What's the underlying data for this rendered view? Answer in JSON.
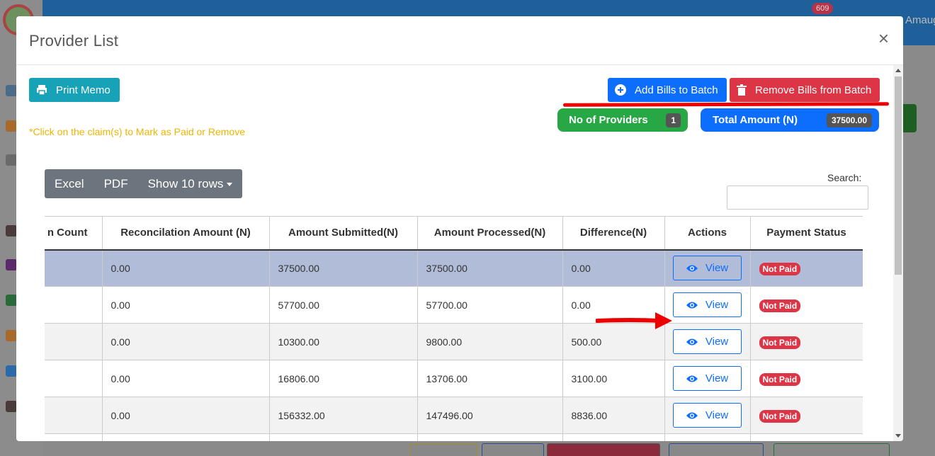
{
  "background": {
    "notification_count": "609",
    "user_name": "Amaug"
  },
  "modal": {
    "title": "Provider List",
    "close_label": "×",
    "print_memo": "Print Memo",
    "add_bills": "Add Bills to Batch",
    "remove_bills": "Remove Bills from Batch",
    "providers_label": "No of Providers",
    "providers_count": "1",
    "total_label": "Total Amount (N)",
    "total_value": "37500.00",
    "hint": "*Click on the claim(s) to Mark as Paid or Remove"
  },
  "table_controls": {
    "excel": "Excel",
    "pdf": "PDF",
    "show_rows": "Show 10 rows",
    "search_label": "Search:",
    "search_value": ""
  },
  "table": {
    "headers": [
      "n Count",
      "Reconcilation Amount (N)",
      "Amount Submitted(N)",
      "Amount Processed(N)",
      "Difference(N)",
      "Actions",
      "Payment Status"
    ],
    "view_label": "View",
    "rows": [
      {
        "count": "",
        "reconciliation": "0.00",
        "submitted": "37500.00",
        "processed": "37500.00",
        "difference": "0.00",
        "status": "Not Paid"
      },
      {
        "count": "",
        "reconciliation": "0.00",
        "submitted": "57700.00",
        "processed": "57700.00",
        "difference": "0.00",
        "status": "Not Paid"
      },
      {
        "count": "",
        "reconciliation": "0.00",
        "submitted": "10300.00",
        "processed": "9800.00",
        "difference": "500.00",
        "status": "Not Paid"
      },
      {
        "count": "",
        "reconciliation": "0.00",
        "submitted": "16806.00",
        "processed": "13706.00",
        "difference": "3100.00",
        "status": "Not Paid"
      },
      {
        "count": "",
        "reconciliation": "0.00",
        "submitted": "156332.00",
        "processed": "147496.00",
        "difference": "8836.00",
        "status": "Not Paid"
      },
      {
        "count": "",
        "reconciliation": "",
        "submitted": "",
        "processed": "",
        "difference": "",
        "status": ""
      }
    ]
  },
  "colors": {
    "primary": "#0d6efd",
    "danger": "#dc3545",
    "success": "#28a745",
    "info": "#17a2b8",
    "selected_row": "#b0bcd8"
  }
}
